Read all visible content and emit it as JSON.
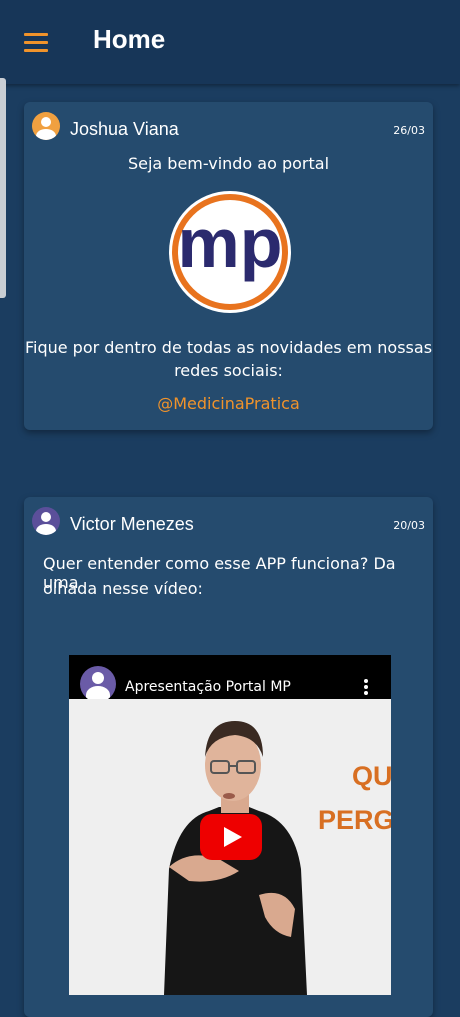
{
  "appbar": {
    "title": "Home"
  },
  "posts": [
    {
      "author": "Joshua Viana",
      "date": "26/03",
      "greeting": "Seja bem-vindo ao portal",
      "logo_text": "mp",
      "body_line1": "Fique por dentro de todas as novidades em nossas",
      "body_line2": "redes sociais:",
      "handle": "@MedicinaPratica"
    },
    {
      "author": "Victor Menezes",
      "date": "20/03",
      "body_line1": "Quer entender como esse APP funciona? Da uma",
      "body_line2": "olhada nesse vídeo:",
      "video": {
        "title": "Apresentação Portal MP",
        "overlay_line1": "QUA",
        "overlay_line2": "PERGUN"
      }
    }
  ],
  "colors": {
    "accent": "#f0932b",
    "background": "#1b3d60",
    "appbar": "#173658",
    "card": "#254b6e",
    "logo_navy": "#2b2a6e",
    "logo_orange": "#e8731e",
    "youtube_red": "#ee0000"
  },
  "icons": [
    "menu-icon",
    "user-avatar-icon",
    "more-vert-icon",
    "play-icon"
  ]
}
